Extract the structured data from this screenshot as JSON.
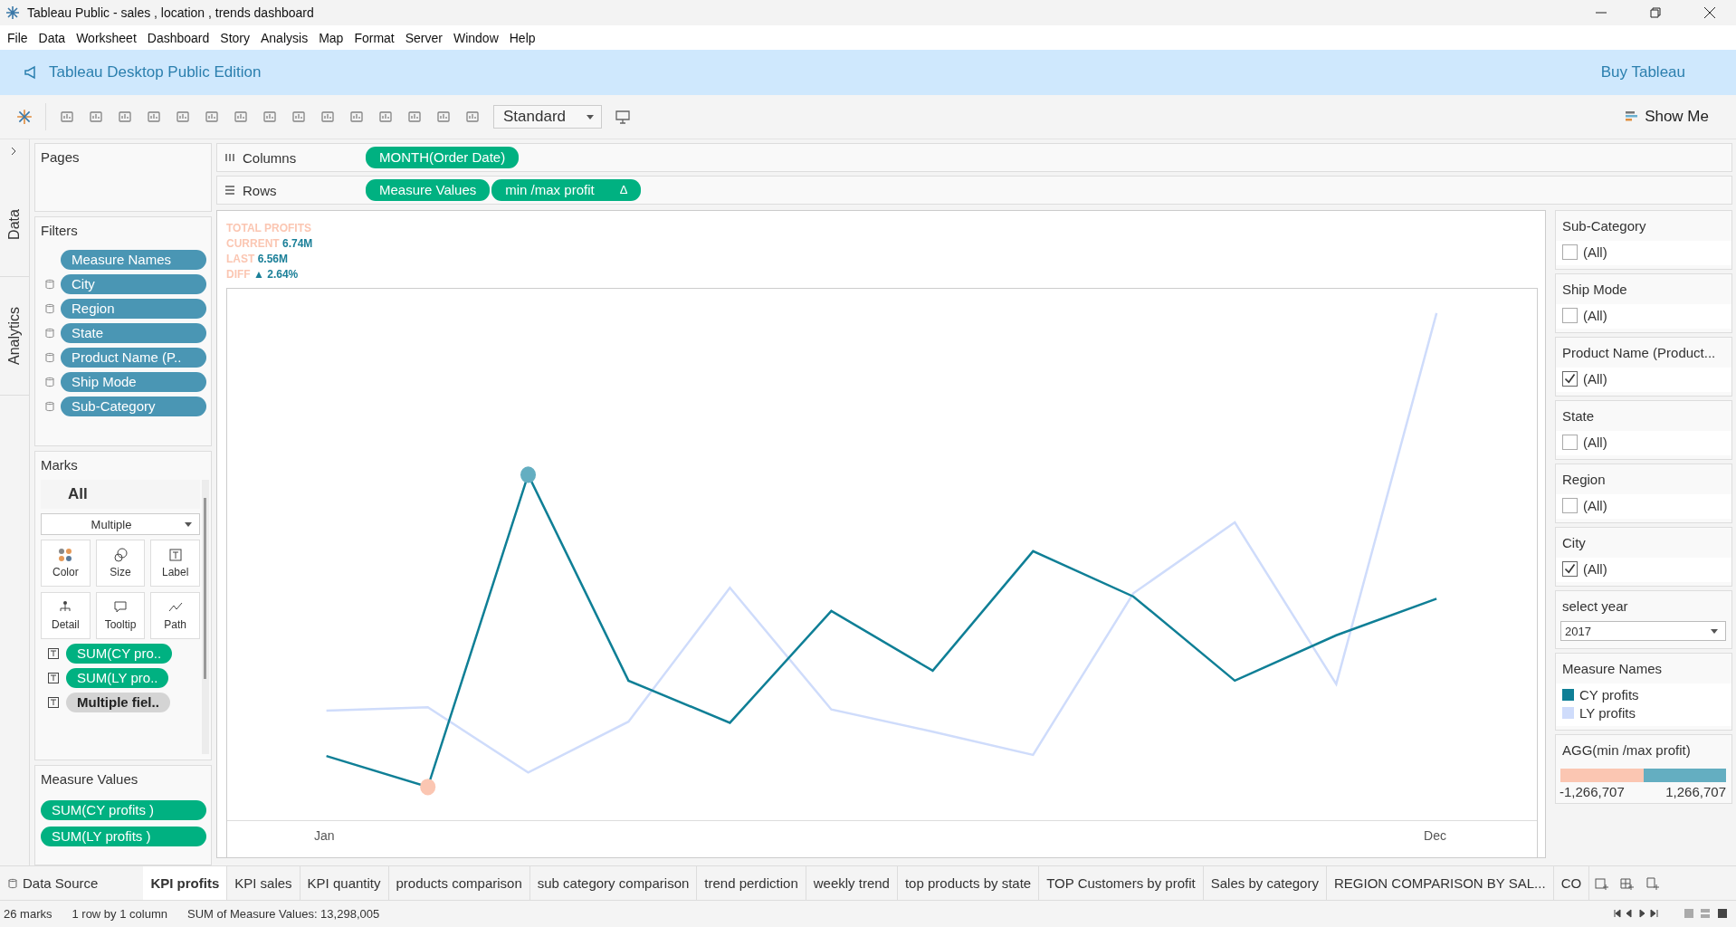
{
  "window": {
    "title": "Tableau Public - sales , location , trends dashboard"
  },
  "menu": [
    "File",
    "Data",
    "Worksheet",
    "Dashboard",
    "Story",
    "Analysis",
    "Map",
    "Format",
    "Server",
    "Window",
    "Help"
  ],
  "banner": {
    "title": "Tableau Desktop Public Edition",
    "link": "Buy Tableau"
  },
  "toolbar": {
    "fit": "Standard",
    "show_me": "Show Me"
  },
  "side_tabs": [
    "Data",
    "Analytics"
  ],
  "pages": {
    "title": "Pages"
  },
  "filters": {
    "title": "Filters",
    "pills": [
      {
        "label": "Measure Names",
        "kind": "plain"
      },
      {
        "label": "City",
        "kind": "dimension"
      },
      {
        "label": "Region",
        "kind": "dimension"
      },
      {
        "label": "State",
        "kind": "dimension"
      },
      {
        "label": "Product Name (P..",
        "kind": "dimension"
      },
      {
        "label": "Ship Mode",
        "kind": "dimension"
      },
      {
        "label": "Sub-Category",
        "kind": "dimension"
      }
    ]
  },
  "marks": {
    "title": "Marks",
    "all": "All",
    "type": "Multiple",
    "buttons": [
      "Color",
      "Size",
      "Label",
      "Detail",
      "Tooltip",
      "Path"
    ],
    "fields": [
      {
        "label": "SUM(CY pro..",
        "kind": "measure"
      },
      {
        "label": "SUM(LY pro..",
        "kind": "measure"
      },
      {
        "label": "Multiple fiel..",
        "kind": "multiple"
      }
    ]
  },
  "measure_values": {
    "title": "Measure Values",
    "pills": [
      "SUM(CY profits )",
      "SUM(LY profits )"
    ]
  },
  "shelves": [
    {
      "title": "Columns",
      "pills": [
        {
          "label": "MONTH(Order Date)"
        }
      ]
    },
    {
      "title": "Rows",
      "pills": [
        {
          "label": "Measure Values"
        },
        {
          "label": "min /max profit",
          "badge": "Δ"
        }
      ]
    }
  ],
  "kpi": {
    "title": "TOTAL PROFITS",
    "lines": [
      {
        "label": "CURRENT",
        "value": "6.74M"
      },
      {
        "label": "LAST",
        "value": "6.56M"
      },
      {
        "label": "DIFF",
        "value": "▲ 2.64%"
      }
    ]
  },
  "axis_labels": [
    "Jan",
    "Dec"
  ],
  "quick_filters": [
    {
      "title": "Sub-Category",
      "items": [
        {
          "label": "(All)",
          "checked": false
        }
      ]
    },
    {
      "title": "Ship Mode",
      "items": [
        {
          "label": "(All)",
          "checked": false
        }
      ]
    },
    {
      "title": "Product Name (Product...",
      "items": [
        {
          "label": "(All)",
          "checked": true
        }
      ]
    },
    {
      "title": "State",
      "items": [
        {
          "label": "(All)",
          "checked": false
        }
      ]
    },
    {
      "title": "Region",
      "items": [
        {
          "label": "(All)",
          "checked": false
        }
      ]
    },
    {
      "title": "City",
      "items": [
        {
          "label": "(All)",
          "checked": true
        }
      ]
    }
  ],
  "select_year": {
    "title": "select year",
    "value": "2017"
  },
  "legend": {
    "title": "Measure Names",
    "items": [
      {
        "label": "CY profits",
        "color": "#0f7f96"
      },
      {
        "label": "LY profits",
        "color": "#cfdcfb"
      }
    ]
  },
  "range_legend": {
    "title": "AGG(min /max profit)",
    "min": "-1,266,707",
    "max": "1,266,707"
  },
  "sheet_tabs": [
    {
      "label": "KPI profits",
      "selected": true
    },
    {
      "label": "KPI sales",
      "selected": false
    },
    {
      "label": "KPI quantity",
      "selected": false
    },
    {
      "label": "products comparison",
      "selected": false
    },
    {
      "label": "sub category comparison",
      "selected": false
    },
    {
      "label": "trend perdiction",
      "selected": false
    },
    {
      "label": "weekly trend",
      "selected": false
    },
    {
      "label": "top products by state",
      "selected": false
    },
    {
      "label": "TOP Customers by profit",
      "selected": false
    },
    {
      "label": "Sales by category",
      "selected": false
    },
    {
      "label": "REGION COMPARISON BY SAL...",
      "selected": false
    },
    {
      "label": "CO",
      "selected": false
    }
  ],
  "data_source": "Data Source",
  "status_bar": [
    "26 marks",
    "1 row by 1 column",
    "SUM of Measure Values: 13,298,005"
  ]
}
